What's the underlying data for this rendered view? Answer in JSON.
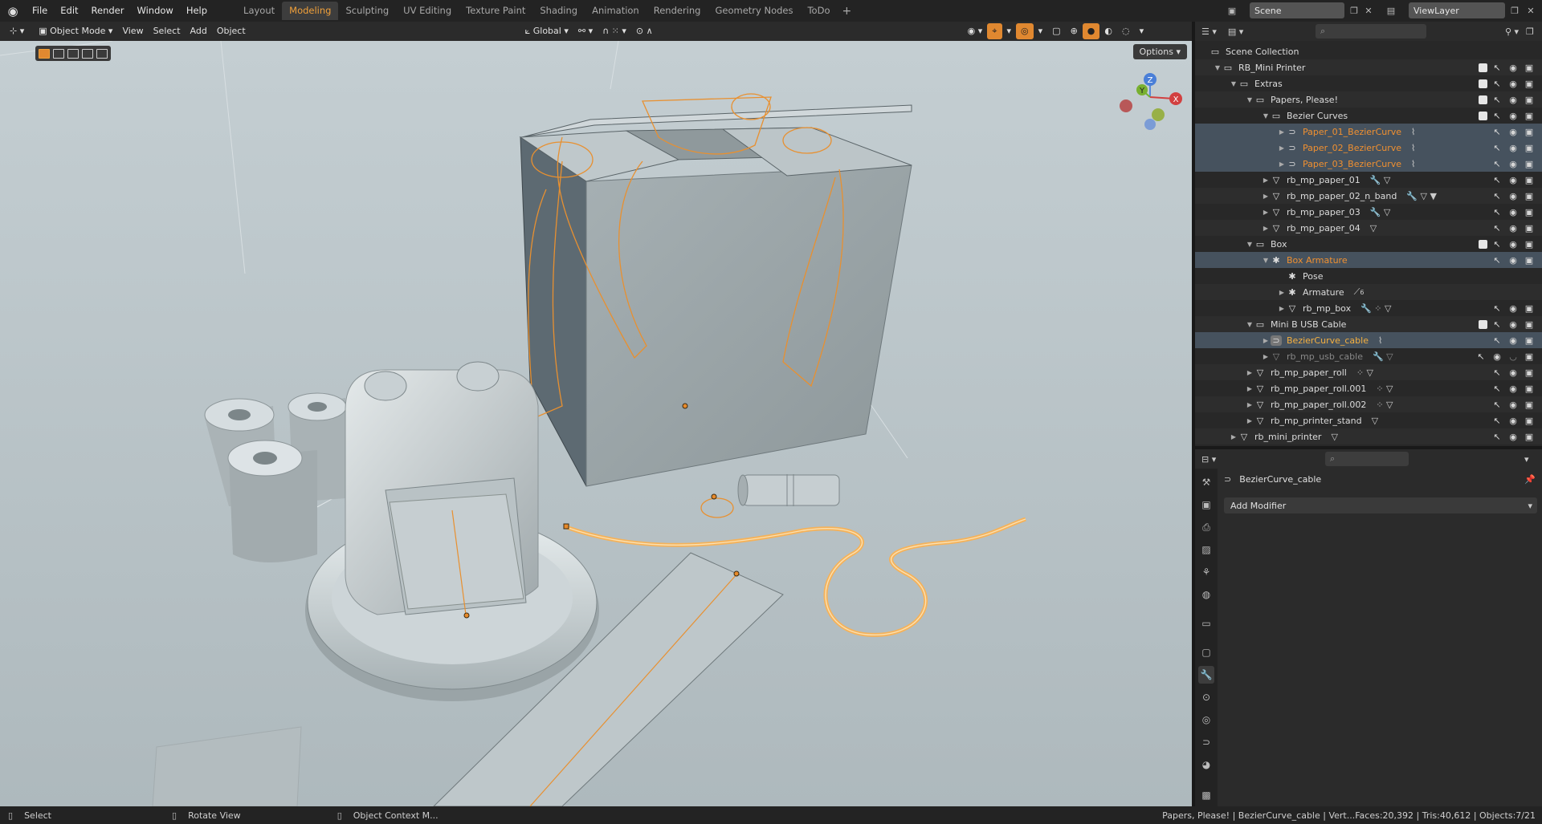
{
  "menu": [
    "File",
    "Edit",
    "Render",
    "Window",
    "Help"
  ],
  "workspaces": [
    "Layout",
    "Modeling",
    "Sculpting",
    "UV Editing",
    "Texture Paint",
    "Shading",
    "Animation",
    "Rendering",
    "Geometry Nodes",
    "ToDo"
  ],
  "active_workspace": "Modeling",
  "scene": "Scene",
  "view_layer": "ViewLayer",
  "viewport_header": {
    "mode": "Object Mode",
    "view": "View",
    "select": "Select",
    "add": "Add",
    "object": "Object",
    "orientation": "Global",
    "options": "Options"
  },
  "gizmo": {
    "z": "Z",
    "y": "Y",
    "x": "X"
  },
  "outliner": {
    "scene_collection": "Scene Collection",
    "rows": [
      {
        "label": "RB_Mini Printer"
      },
      {
        "label": "Extras"
      },
      {
        "label": "Papers, Please!"
      },
      {
        "label": "Bezier Curves"
      },
      {
        "label": "Paper_01_BezierCurve"
      },
      {
        "label": "Paper_02_BezierCurve"
      },
      {
        "label": "Paper_03_BezierCurve"
      },
      {
        "label": "rb_mp_paper_01"
      },
      {
        "label": "rb_mp_paper_02_n_band"
      },
      {
        "label": "rb_mp_paper_03"
      },
      {
        "label": "rb_mp_paper_04"
      },
      {
        "label": "Box"
      },
      {
        "label": "Box Armature"
      },
      {
        "label": "Pose"
      },
      {
        "label": "Armature",
        "badge": "6"
      },
      {
        "label": "rb_mp_box"
      },
      {
        "label": "Mini B USB Cable"
      },
      {
        "label": "BezierCurve_cable"
      },
      {
        "label": "rb_mp_usb_cable"
      },
      {
        "label": "rb_mp_paper_roll"
      },
      {
        "label": "rb_mp_paper_roll.001"
      },
      {
        "label": "rb_mp_paper_roll.002"
      },
      {
        "label": "rb_mp_printer_stand"
      },
      {
        "label": "rb_mini_printer"
      }
    ]
  },
  "properties": {
    "object_name": "BezierCurve_cable",
    "add_modifier": "Add Modifier"
  },
  "statusbar": {
    "select": "Select",
    "rotate": "Rotate View",
    "context": "Object Context M...",
    "stats": "Papers, Please! | BezierCurve_cable | Vert...Faces:20,392 | Tris:40,612 | Objects:7/21"
  },
  "colors": {
    "accent": "#f09030",
    "selection_row": "#46525e",
    "viewport_bg": "#b8c3c7"
  }
}
